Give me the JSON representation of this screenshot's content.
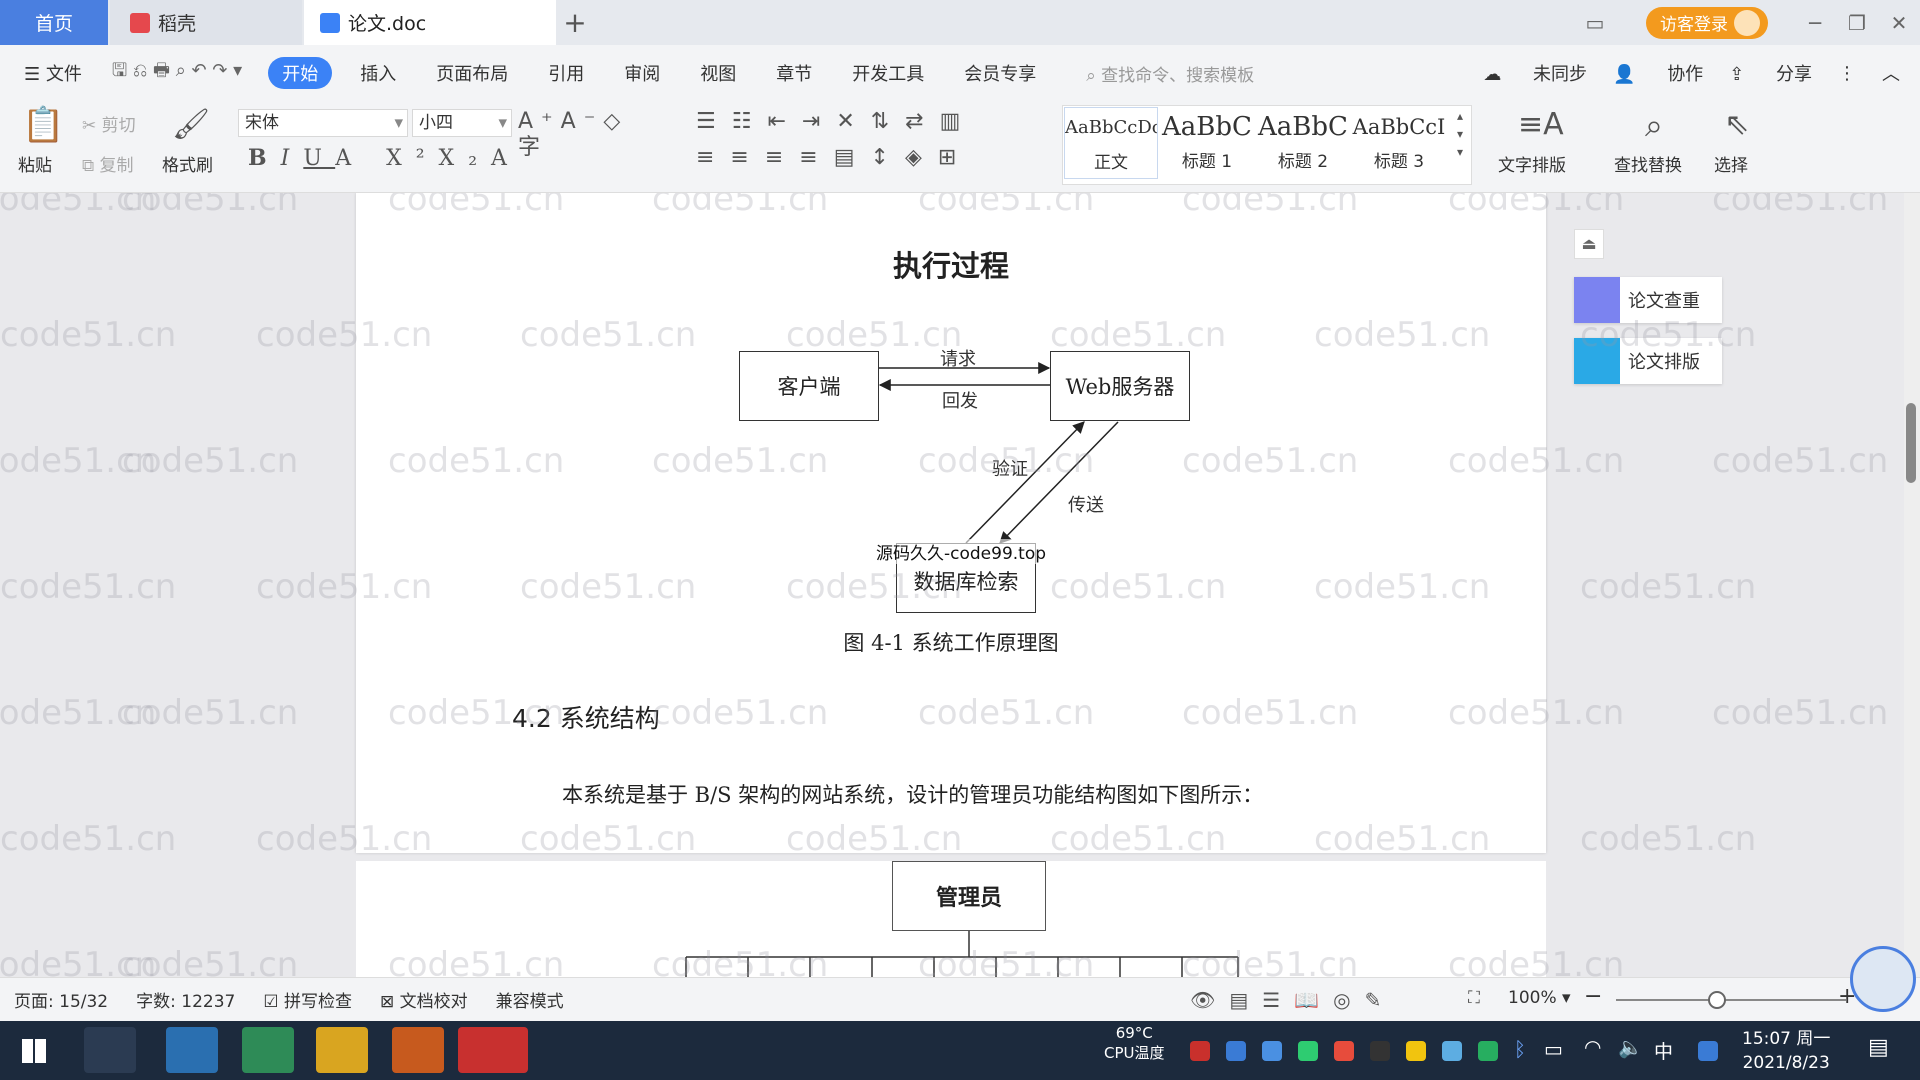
{
  "tabs": {
    "home": "首页",
    "daoke": "稻壳",
    "doc": "论文.doc"
  },
  "titlebar": {
    "login": "访客登录"
  },
  "menu": {
    "file": "文件",
    "items": [
      "开始",
      "插入",
      "页面布局",
      "引用",
      "审阅",
      "视图",
      "章节",
      "开发工具",
      "会员专享"
    ],
    "search": "查找命令、搜索模板",
    "right": [
      "未同步",
      "协作",
      "分享"
    ]
  },
  "ribbon": {
    "paste": "粘贴",
    "cut": "剪切",
    "copy": "复制",
    "format_painter": "格式刷",
    "font_name": "宋体",
    "font_size": "小四",
    "styles": [
      {
        "sample": "AaBbCcDc",
        "name": "正文"
      },
      {
        "sample": "AaBbC",
        "name": "标题 1"
      },
      {
        "sample": "AaBbC",
        "name": "标题 2"
      },
      {
        "sample": "AaBbCcI",
        "name": "标题 3"
      }
    ],
    "text_layout": "文字排版",
    "find_replace": "查找替换",
    "select": "选择"
  },
  "document": {
    "section_title": "执行过程",
    "diagram": {
      "client": "客户端",
      "server": "Web服务器",
      "request": "请求",
      "reply": "回发",
      "verify": "验证",
      "transfer": "传送",
      "db": "数据库检索",
      "overlay": "源码久久-code99.top"
    },
    "figure_caption": "图 4-1 系统工作原理图",
    "heading": "4.2 系统结构",
    "paragraph": "本系统是基于 B/S 架构的网站系统，设计的管理员功能结构图如下图所示：",
    "admin_box": "管理员",
    "watermark": "code51.cn"
  },
  "side_panel": {
    "check": "论文查重",
    "layout": "论文排版"
  },
  "status": {
    "page": "页面: 15/32",
    "words": "字数: 12237",
    "spell": "拼写检查",
    "proof": "文档校对",
    "compat": "兼容模式",
    "zoom": "100%"
  },
  "taskbar": {
    "cpu_temp": "69°C",
    "cpu_label": "CPU温度",
    "time": "15:07 周一",
    "date": "2021/8/23",
    "ime": "中"
  }
}
